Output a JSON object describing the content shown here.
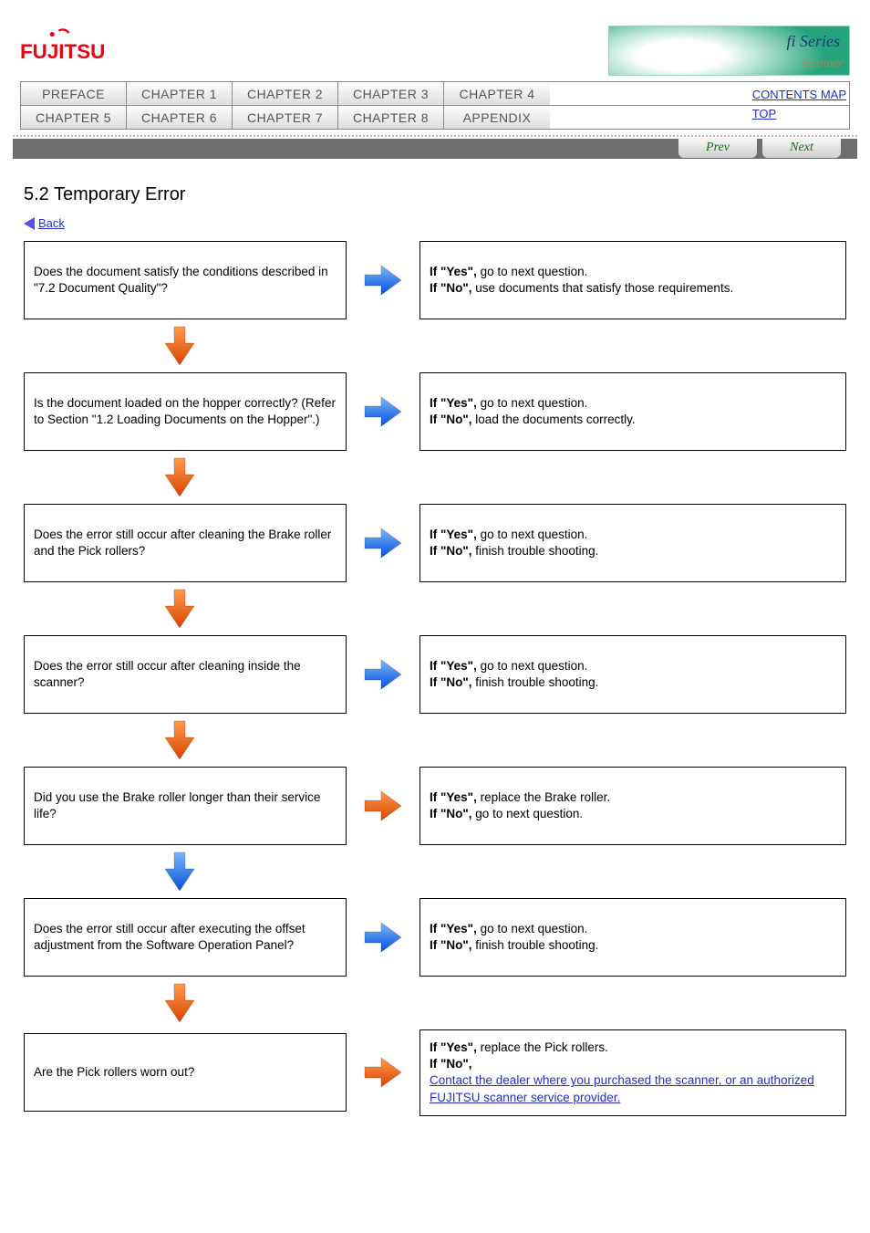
{
  "logo_text": "FUJITSU",
  "banner": {
    "title_text": "fi Series",
    "sub_text": "Scanner"
  },
  "tabs_row1": [
    "PREFACE",
    "CHAPTER 1",
    "CHAPTER 2",
    "CHAPTER 3",
    "CHAPTER 4"
  ],
  "tabs_row2": [
    "CHAPTER 5",
    "CHAPTER 6",
    "CHAPTER 7",
    "CHAPTER 8",
    "APPENDIX"
  ],
  "top_links": [
    "CONTENTS MAP",
    "TOP"
  ],
  "prev_label": "Prev",
  "next_label": "Next",
  "section_title": "5.2 Temporary Error",
  "back_label": "Back",
  "steps": [
    {
      "q": "Does the document satisfy the conditions described in \"7.2 Document Quality\"?",
      "yes_prefix": "If \"Yes\",",
      "yes_rest": " go to next question.",
      "no_prefix": "If \"No\",",
      "no_rest": " use documents that satisfy those requirements.",
      "arrow": "blue",
      "down": "orange"
    },
    {
      "q": "Is the document loaded on the hopper correctly? (Refer to Section \"1.2 Loading Documents on the Hopper\".)",
      "yes_prefix": "If \"Yes\",",
      "yes_rest": " go to next question.",
      "no_prefix": "If \"No\",",
      "no_rest": " load the documents correctly.",
      "arrow": "blue",
      "down": "orange"
    },
    {
      "q": "Does the error still occur after cleaning the Brake roller and the Pick rollers?",
      "yes_prefix": "If \"Yes\",",
      "yes_rest": " go to next question.",
      "no_prefix": "If \"No\",",
      "no_rest": " finish trouble shooting.",
      "arrow": "blue",
      "down": "orange"
    },
    {
      "q": "Does the error still occur after cleaning inside the scanner?",
      "yes_prefix": "If \"Yes\",",
      "yes_rest": " go to next question.",
      "no_prefix": "If \"No\",",
      "no_rest": " finish trouble shooting.",
      "arrow": "blue",
      "down": "orange"
    },
    {
      "q": "Did you use the Brake roller longer than their service life?",
      "yes_prefix": "If \"Yes\",",
      "yes_rest": " replace the Brake roller.",
      "no_prefix": "If \"No\",",
      "no_rest": " go to next question.",
      "arrow": "orange",
      "down": "blue"
    },
    {
      "q": "Does the error still occur after executing the offset adjustment from the Software Operation Panel?",
      "yes_prefix": "If \"Yes\",",
      "yes_rest": " go to next question.",
      "no_prefix": "If \"No\",",
      "no_rest": " finish trouble shooting.",
      "arrow": "blue",
      "down": "orange"
    },
    {
      "q": "Are the Pick rollers worn out?",
      "yes_prefix": "If \"Yes\",",
      "yes_rest": " replace the Pick rollers.",
      "no_prefix": "If \"No\",",
      "no_final": "Contact the dealer where you purchased the scanner, or an authorized FUJITSU scanner service provider.",
      "arrow": "orange",
      "down": null
    }
  ],
  "colors": {
    "orange": "#ff6a13",
    "blue": "#2a7bff"
  }
}
